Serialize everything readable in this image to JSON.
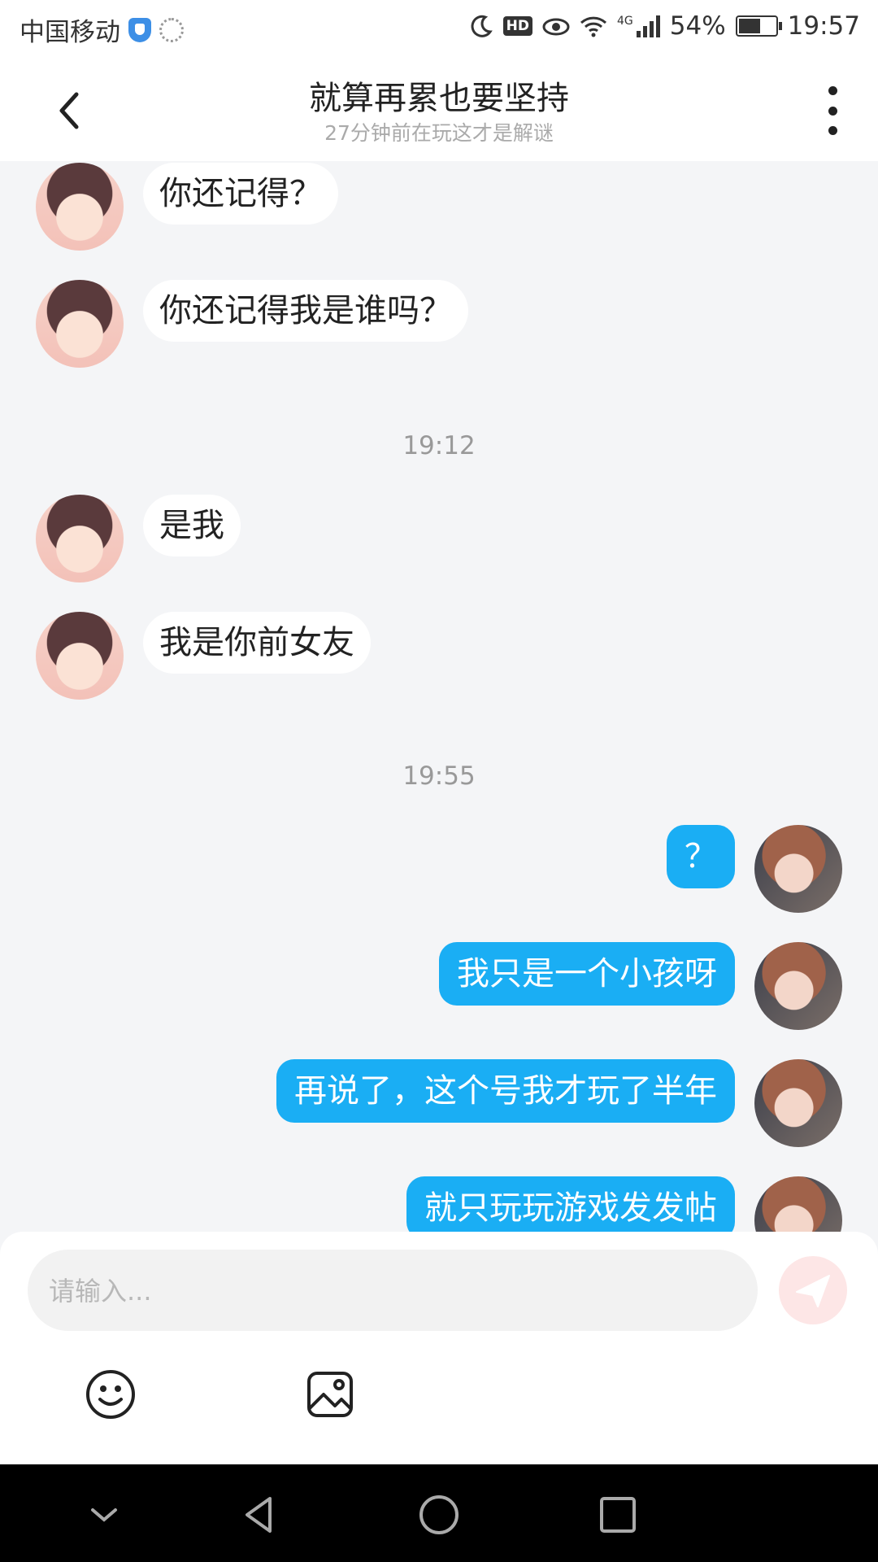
{
  "status_bar": {
    "carrier": "中国移动",
    "network": "4G",
    "battery": "54%",
    "time": "19:57"
  },
  "header": {
    "title": "就算再累也要坚持",
    "subtitle": "27分钟前在玩这才是解谜"
  },
  "messages": [
    {
      "side": "in",
      "text": "你还记得？"
    },
    {
      "side": "in",
      "text": "你还记得我是谁吗？"
    },
    {
      "time": "19:12"
    },
    {
      "side": "in",
      "text": "是我"
    },
    {
      "side": "in",
      "text": "我是你前女友"
    },
    {
      "time": "19:55"
    },
    {
      "side": "out",
      "text": "？"
    },
    {
      "side": "out",
      "text": "我只是一个小孩呀"
    },
    {
      "side": "out",
      "text": "再说了，这个号我才玩了半年"
    },
    {
      "side": "out",
      "text": "就只玩玩游戏发发帖"
    }
  ],
  "input": {
    "placeholder": "请输入..."
  },
  "icons": {
    "back": "chevron-left-icon",
    "more": "more-vertical-icon",
    "send": "paper-plane-icon",
    "emoji": "smiley-icon",
    "image": "image-icon",
    "nav_down": "chevron-down-icon",
    "nav_back": "triangle-back-icon",
    "nav_home": "circle-home-icon",
    "nav_recent": "square-recent-icon"
  },
  "colors": {
    "outgoing_bubble": "#1aaef4",
    "incoming_bubble": "#ffffff",
    "chat_background": "#f4f5f7",
    "send_button": "#fde6e6"
  }
}
